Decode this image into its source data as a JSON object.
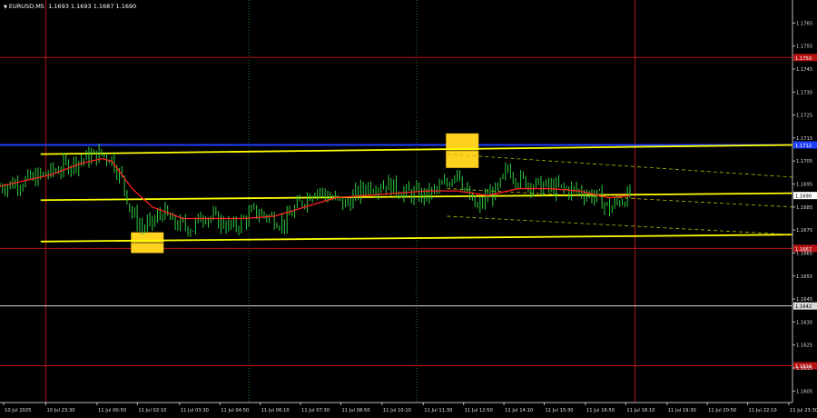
{
  "window": {
    "symbol_label": "EURUSD,M5",
    "ohlc_label": "1.1693 1.1693 1.1687 1.1690"
  },
  "colors": {
    "background": "#000000",
    "candle": "#2ecc40",
    "support_line": "#ffff00",
    "dashed_channel": "#b8b800",
    "moving_average": "#ff2222",
    "blue_level": "#1f3fff",
    "red_level": "#b81414",
    "white_level": "#d8d8d8",
    "day_separator": "#b81414",
    "session_separator": "#2e7a2e",
    "signal_box": "#ffd21f",
    "price_label_red": "#b81414",
    "price_label_blue": "#1f3fff",
    "price_label_current": "#ffffff"
  },
  "chart_data": {
    "type": "candlestick",
    "title": "",
    "ylim": [
      1.16,
      1.1775
    ],
    "y_ticks": [
      "1.1765",
      "1.1755",
      "1.1745",
      "1.1735",
      "1.1725",
      "1.1715",
      "1.1705",
      "1.1695",
      "1.1685",
      "1.1675",
      "1.1665",
      "1.1655",
      "1.1645",
      "1.1635",
      "1.1625",
      "1.1615",
      "1.1605"
    ],
    "x_ticks": [
      "10 Jul 2025",
      "10 Jul 23:30",
      "11 Jul 00:50",
      "11 Jul 02:10",
      "11 Jul 03:30",
      "11 Jul 04:50",
      "11 Jul 06:10",
      "11 Jul 07:30",
      "11 Jul 08:50",
      "11 Jul 10:10",
      "11 Jul 11:30",
      "11 Jul 12:50",
      "11 Jul 14:10",
      "11 Jul 15:30",
      "11 Jul 16:50",
      "11 Jul 18:10",
      "11 Jul 19:30",
      "11 Jul 20:50",
      "11 Jul 22:10",
      "11 Jul 23:30"
    ],
    "levels": [
      {
        "price": 1.175,
        "label": "1.1750",
        "style": "red"
      },
      {
        "price": 1.1712,
        "label": "1.1712",
        "style": "blue"
      },
      {
        "price": 1.1667,
        "label": "1.1667",
        "style": "red"
      },
      {
        "price": 1.1642,
        "label": "1.1642",
        "style": "white"
      },
      {
        "price": 1.1616,
        "label": "1.1616",
        "style": "red"
      }
    ],
    "current_price": {
      "price": 1.169,
      "label": "1.1690"
    },
    "support_lines": [
      {
        "name": "",
        "start": [
          4,
          1.1708
        ],
        "end": [
          74,
          1.1712
        ]
      },
      {
        "name": "",
        "start": [
          4,
          1.1688
        ],
        "end": [
          74,
          1.1691
        ]
      },
      {
        "name": "",
        "start": [
          4,
          1.167
        ],
        "end": [
          74,
          1.1673
        ]
      }
    ],
    "dashed_channel": [
      {
        "start": [
          44,
          1.1708
        ],
        "end": [
          74,
          1.1698
        ]
      },
      {
        "start": [
          44,
          1.1693
        ],
        "end": [
          74,
          1.1685
        ]
      },
      {
        "start": [
          44,
          1.1681
        ],
        "end": [
          74,
          1.1673
        ]
      }
    ],
    "signal_boxes": [
      {
        "x": 14.5,
        "y_low": 1.1665,
        "y_high": 1.1674
      },
      {
        "x": 45.5,
        "y_low": 1.1702,
        "y_high": 1.1717
      }
    ],
    "day_separators": [
      4.5,
      62.5
    ],
    "session_separators": [
      24.5,
      41
    ],
    "price_path": [
      {
        "x": 0,
        "y": 1.1694
      },
      {
        "x": 3,
        "y": 1.1697
      },
      {
        "x": 5,
        "y": 1.17
      },
      {
        "x": 7,
        "y": 1.1704
      },
      {
        "x": 9,
        "y": 1.1707
      },
      {
        "x": 10,
        "y": 1.1708
      },
      {
        "x": 11,
        "y": 1.1706
      },
      {
        "x": 12,
        "y": 1.1697
      },
      {
        "x": 13,
        "y": 1.1682
      },
      {
        "x": 14,
        "y": 1.1676
      },
      {
        "x": 15,
        "y": 1.1678
      },
      {
        "x": 16,
        "y": 1.1683
      },
      {
        "x": 17,
        "y": 1.1678
      },
      {
        "x": 19,
        "y": 1.1676
      },
      {
        "x": 20,
        "y": 1.1682
      },
      {
        "x": 21,
        "y": 1.168
      },
      {
        "x": 23,
        "y": 1.1676
      },
      {
        "x": 25,
        "y": 1.1683
      },
      {
        "x": 27,
        "y": 1.168
      },
      {
        "x": 28,
        "y": 1.1678
      },
      {
        "x": 29,
        "y": 1.1684
      },
      {
        "x": 31,
        "y": 1.1693
      },
      {
        "x": 33,
        "y": 1.1688
      },
      {
        "x": 34,
        "y": 1.1686
      },
      {
        "x": 36,
        "y": 1.1694
      },
      {
        "x": 38,
        "y": 1.1695
      },
      {
        "x": 40,
        "y": 1.1691
      },
      {
        "x": 42,
        "y": 1.169
      },
      {
        "x": 44,
        "y": 1.1695
      },
      {
        "x": 45,
        "y": 1.1702
      },
      {
        "x": 46,
        "y": 1.169
      },
      {
        "x": 47,
        "y": 1.1684
      },
      {
        "x": 48,
        "y": 1.169
      },
      {
        "x": 49,
        "y": 1.1692
      },
      {
        "x": 50,
        "y": 1.1702
      },
      {
        "x": 51,
        "y": 1.1697
      },
      {
        "x": 53,
        "y": 1.1694
      },
      {
        "x": 55,
        "y": 1.1693
      },
      {
        "x": 57,
        "y": 1.1692
      },
      {
        "x": 59,
        "y": 1.1689
      },
      {
        "x": 60,
        "y": 1.1684
      },
      {
        "x": 61,
        "y": 1.1688
      },
      {
        "x": 62,
        "y": 1.169
      }
    ],
    "moving_average": [
      {
        "x": 0,
        "y": 1.1694
      },
      {
        "x": 5,
        "y": 1.1699
      },
      {
        "x": 8,
        "y": 1.1704
      },
      {
        "x": 10,
        "y": 1.1706
      },
      {
        "x": 11,
        "y": 1.1705
      },
      {
        "x": 13,
        "y": 1.1693
      },
      {
        "x": 15,
        "y": 1.1685
      },
      {
        "x": 18,
        "y": 1.168
      },
      {
        "x": 21,
        "y": 1.168
      },
      {
        "x": 24,
        "y": 1.168
      },
      {
        "x": 27,
        "y": 1.1681
      },
      {
        "x": 30,
        "y": 1.1685
      },
      {
        "x": 33,
        "y": 1.1689
      },
      {
        "x": 36,
        "y": 1.169
      },
      {
        "x": 39,
        "y": 1.1691
      },
      {
        "x": 42,
        "y": 1.1692
      },
      {
        "x": 45,
        "y": 1.1692
      },
      {
        "x": 48,
        "y": 1.169
      },
      {
        "x": 51,
        "y": 1.1693
      },
      {
        "x": 54,
        "y": 1.1693
      },
      {
        "x": 57,
        "y": 1.1692
      },
      {
        "x": 60,
        "y": 1.1689
      },
      {
        "x": 62,
        "y": 1.169
      }
    ]
  }
}
